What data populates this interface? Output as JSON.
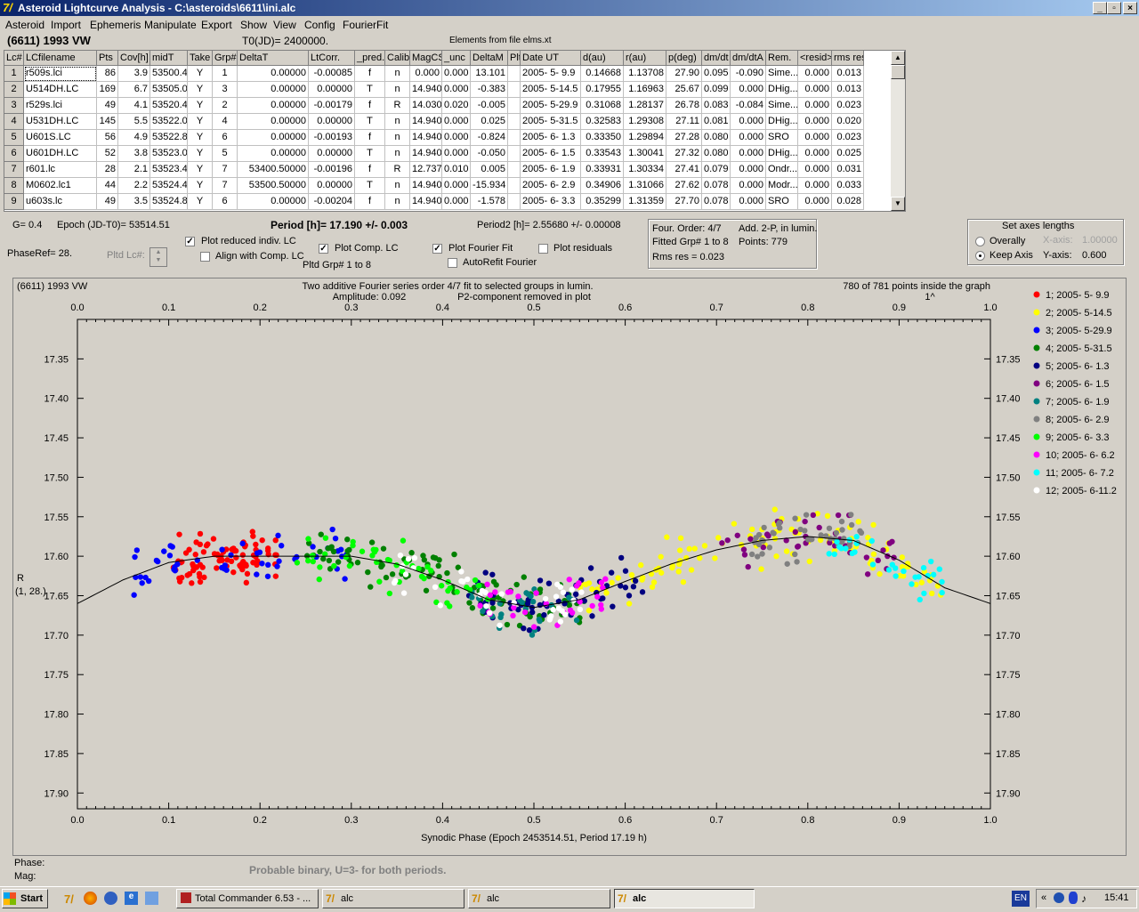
{
  "window": {
    "title": "Asteroid Lightcurve Analysis - C:\\asteroids\\6611\\ini.alc",
    "icon": "alc-app-icon"
  },
  "menu": [
    "Asteroid",
    "Import",
    "Ephemeris",
    "Manipulate",
    "Export",
    "Show",
    "View",
    "Config",
    "FourierFit"
  ],
  "header": {
    "asteroid": "(6611) 1993 VW",
    "t0": "T0(JD)= 2400000.",
    "elements": "Elements from file elms.xt"
  },
  "table": {
    "columns": [
      "Lc#",
      "LCfilename",
      "Pts",
      "Cov[h]",
      "midT",
      "Take",
      "Grp#",
      "DeltaT",
      "LtCorr.",
      "_pred.",
      "Calib.",
      "MagCS",
      "_unc",
      "DeltaM",
      "Plt",
      "Date UT",
      "d(au)",
      "r(au)",
      "p(deg)",
      "dm/dt",
      "dm/dtA",
      "Rem.",
      "<resid>",
      "rms res"
    ],
    "rows": [
      [
        "1",
        "r509s.lci",
        "86",
        "3.9",
        "53500.4",
        "Y",
        "1",
        "0.00000",
        "-0.00085",
        "f",
        "n",
        "0.000",
        "0.000",
        "13.101",
        "",
        "2005- 5- 9.9",
        "0.14668",
        "1.13708",
        "27.90",
        "0.095",
        "-0.090",
        "Sime...",
        "0.000",
        "0.013"
      ],
      [
        "2",
        "U514DH.LC",
        "169",
        "6.7",
        "53505.0",
        "Y",
        "3",
        "0.00000",
        "0.00000",
        "T",
        "n",
        "14.940",
        "0.000",
        "-0.383",
        "",
        "2005- 5-14.5",
        "0.17955",
        "1.16963",
        "25.67",
        "0.099",
        "0.000",
        "DHig...",
        "0.000",
        "0.013"
      ],
      [
        "3",
        "r529s.lci",
        "49",
        "4.1",
        "53520.4",
        "Y",
        "2",
        "0.00000",
        "-0.00179",
        "f",
        "R",
        "14.030",
        "0.020",
        "-0.005",
        "",
        "2005- 5-29.9",
        "0.31068",
        "1.28137",
        "26.78",
        "0.083",
        "-0.084",
        "Sime...",
        "0.000",
        "0.023"
      ],
      [
        "4",
        "U531DH.LC",
        "145",
        "5.5",
        "53522.0",
        "Y",
        "4",
        "0.00000",
        "0.00000",
        "T",
        "n",
        "14.940",
        "0.000",
        "0.025",
        "",
        "2005- 5-31.5",
        "0.32583",
        "1.29308",
        "27.11",
        "0.081",
        "0.000",
        "DHig...",
        "0.000",
        "0.020"
      ],
      [
        "5",
        "U601S.LC",
        "56",
        "4.9",
        "53522.8",
        "Y",
        "6",
        "0.00000",
        "-0.00193",
        "f",
        "n",
        "14.940",
        "0.000",
        "-0.824",
        "",
        "2005- 6- 1.3",
        "0.33350",
        "1.29894",
        "27.28",
        "0.080",
        "0.000",
        "SRO",
        "0.000",
        "0.023"
      ],
      [
        "6",
        "U601DH.LC",
        "52",
        "3.8",
        "53523.0",
        "Y",
        "5",
        "0.00000",
        "0.00000",
        "T",
        "n",
        "14.940",
        "0.000",
        "-0.050",
        "",
        "2005- 6- 1.5",
        "0.33543",
        "1.30041",
        "27.32",
        "0.080",
        "0.000",
        "DHig...",
        "0.000",
        "0.025"
      ],
      [
        "7",
        "r601.lc",
        "28",
        "2.1",
        "53523.4",
        "Y",
        "7",
        "53400.50000",
        "-0.00196",
        "f",
        "R",
        "12.737",
        "0.010",
        "0.005",
        "",
        "2005- 6- 1.9",
        "0.33931",
        "1.30334",
        "27.41",
        "0.079",
        "0.000",
        "Ondr...",
        "0.000",
        "0.031"
      ],
      [
        "8",
        "M0602.lc1",
        "44",
        "2.2",
        "53524.4",
        "Y",
        "7",
        "53500.50000",
        "0.00000",
        "T",
        "n",
        "14.940",
        "0.000",
        "-15.934",
        "",
        "2005- 6- 2.9",
        "0.34906",
        "1.31066",
        "27.62",
        "0.078",
        "0.000",
        "Modr...",
        "0.000",
        "0.033"
      ],
      [
        "9",
        "u603s.lc",
        "49",
        "3.5",
        "53524.8",
        "Y",
        "6",
        "0.00000",
        "-0.00204",
        "f",
        "n",
        "14.940",
        "0.000",
        "-1.578",
        "",
        "2005- 6- 3.3",
        "0.35299",
        "1.31359",
        "27.70",
        "0.078",
        "0.000",
        "SRO",
        "0.000",
        "0.028"
      ]
    ]
  },
  "controls": {
    "g": "G= 0.4",
    "epoch": "Epoch (JD-T0)= 53514.51",
    "period": "Period [h]= 17.190 +/- 0.003",
    "period2": "Period2 [h]= 2.55680 +/- 0.00008",
    "phaseref": "PhaseRef= 28.",
    "pltd_lc": "Pltd Lc#:",
    "plot_reduced": "Plot reduced indiv. LC",
    "align": "Align with Comp. LC",
    "plot_comp": "Plot Comp. LC",
    "pltd_grp": "Pltd Grp#  1   to   8",
    "plot_fourier": "Plot Fourier Fit",
    "autorefit": "AutoRefit Fourier",
    "plot_residuals": "Plot residuals",
    "fourier_order": "Four. Order:  4/7",
    "add2p": "Add. 2-P, in lumin.",
    "fitted_grp": "Fitted Grp# 1 to 8",
    "points": "Points: 779",
    "rms": "Rms res       = 0.023",
    "axes_title": "Set axes lengths",
    "overally": "Overally",
    "keep_axis": "Keep Axis",
    "xaxis_lbl": "X-axis:",
    "xaxis_val": "1.00000",
    "yaxis_lbl": "Y-axis:",
    "yaxis_val": "0.600"
  },
  "plot": {
    "name": "(6611) 1993 VW",
    "desc1": "Two additive Fourier series order 4/7 fit to selected groups in lumin.",
    "desc2": "Amplitude: 0.092",
    "desc3": "P2-component removed in plot",
    "points_inside": "780 of 781 points inside the graph",
    "marker": "1^",
    "ylabel": "R",
    "ylabel2": "(1, 28.)",
    "xlabel": "Synodic Phase (Epoch 2453514.51, Period 17.19 h)"
  },
  "chart_data": {
    "type": "scatter",
    "xlim": [
      0,
      1
    ],
    "ylim": [
      17.3,
      17.92
    ],
    "y_inverted": true,
    "xticks": [
      "0.0",
      "0.1",
      "0.2",
      "0.3",
      "0.4",
      "0.5",
      "0.6",
      "0.7",
      "0.8",
      "0.9",
      "1.0"
    ],
    "yticks": [
      "17.35",
      "17.40",
      "17.45",
      "17.50",
      "17.55",
      "17.60",
      "17.65",
      "17.70",
      "17.75",
      "17.80",
      "17.85",
      "17.90"
    ],
    "legend": [
      {
        "name": "1; 2005- 5- 9.9",
        "color": "#ff0000",
        "x_range": [
          0.1,
          0.22
        ],
        "y_mean": 17.605
      },
      {
        "name": "2; 2005- 5-14.5",
        "color": "#ffff00",
        "x_range": [
          0.55,
          0.95
        ],
        "y_mean": 17.61
      },
      {
        "name": "3; 2005- 5-29.9",
        "color": "#0000ff",
        "x_range": [
          0.06,
          0.3
        ],
        "y_mean": 17.6
      },
      {
        "name": "4; 2005- 5-31.5",
        "color": "#008000",
        "x_range": [
          0.24,
          0.56
        ],
        "y_mean": 17.62
      },
      {
        "name": "5; 2005- 6- 1.3",
        "color": "#000080",
        "x_range": [
          0.42,
          0.62
        ],
        "y_mean": 17.665
      },
      {
        "name": "6; 2005- 6- 1.5",
        "color": "#800080",
        "x_range": [
          0.7,
          0.9
        ],
        "y_mean": 17.59
      },
      {
        "name": "7; 2005- 6- 1.9",
        "color": "#008080",
        "x_range": [
          0.43,
          0.55
        ],
        "y_mean": 17.67
      },
      {
        "name": "8; 2005- 6- 2.9",
        "color": "#808080",
        "x_range": [
          0.73,
          0.86
        ],
        "y_mean": 17.585
      },
      {
        "name": "9; 2005- 6- 3.3",
        "color": "#00ff00",
        "x_range": [
          0.24,
          0.46
        ],
        "y_mean": 17.63
      },
      {
        "name": "10; 2005- 6- 6.2",
        "color": "#ff00ff",
        "x_range": [
          0.44,
          0.58
        ],
        "y_mean": 17.66
      },
      {
        "name": "11; 2005- 6- 7.2",
        "color": "#00ffff",
        "x_range": [
          0.82,
          0.95
        ],
        "y_mean": 17.62
      },
      {
        "name": "12; 2005- 6-11.2",
        "color": "#ffffff",
        "x_range": [
          0.34,
          0.56
        ],
        "y_mean": 17.65
      }
    ],
    "fit_curve": {
      "x": [
        0,
        0.05,
        0.1,
        0.15,
        0.2,
        0.25,
        0.3,
        0.35,
        0.4,
        0.45,
        0.5,
        0.55,
        0.6,
        0.65,
        0.7,
        0.75,
        0.8,
        0.85,
        0.9,
        0.95,
        1.0
      ],
      "y": [
        17.66,
        17.63,
        17.608,
        17.6,
        17.6,
        17.6,
        17.6,
        17.61,
        17.63,
        17.655,
        17.665,
        17.655,
        17.632,
        17.61,
        17.592,
        17.58,
        17.575,
        17.58,
        17.605,
        17.64,
        17.66
      ]
    }
  },
  "footer": {
    "phase": "Phase:",
    "mag": "Mag:",
    "note": "Probable binary, U=3- for both periods."
  },
  "taskbar": {
    "start": "Start",
    "tasks": [
      "Total Commander 6.53 - ...",
      "alc",
      "alc",
      "alc"
    ],
    "lang": "EN",
    "clock": "15:41"
  }
}
